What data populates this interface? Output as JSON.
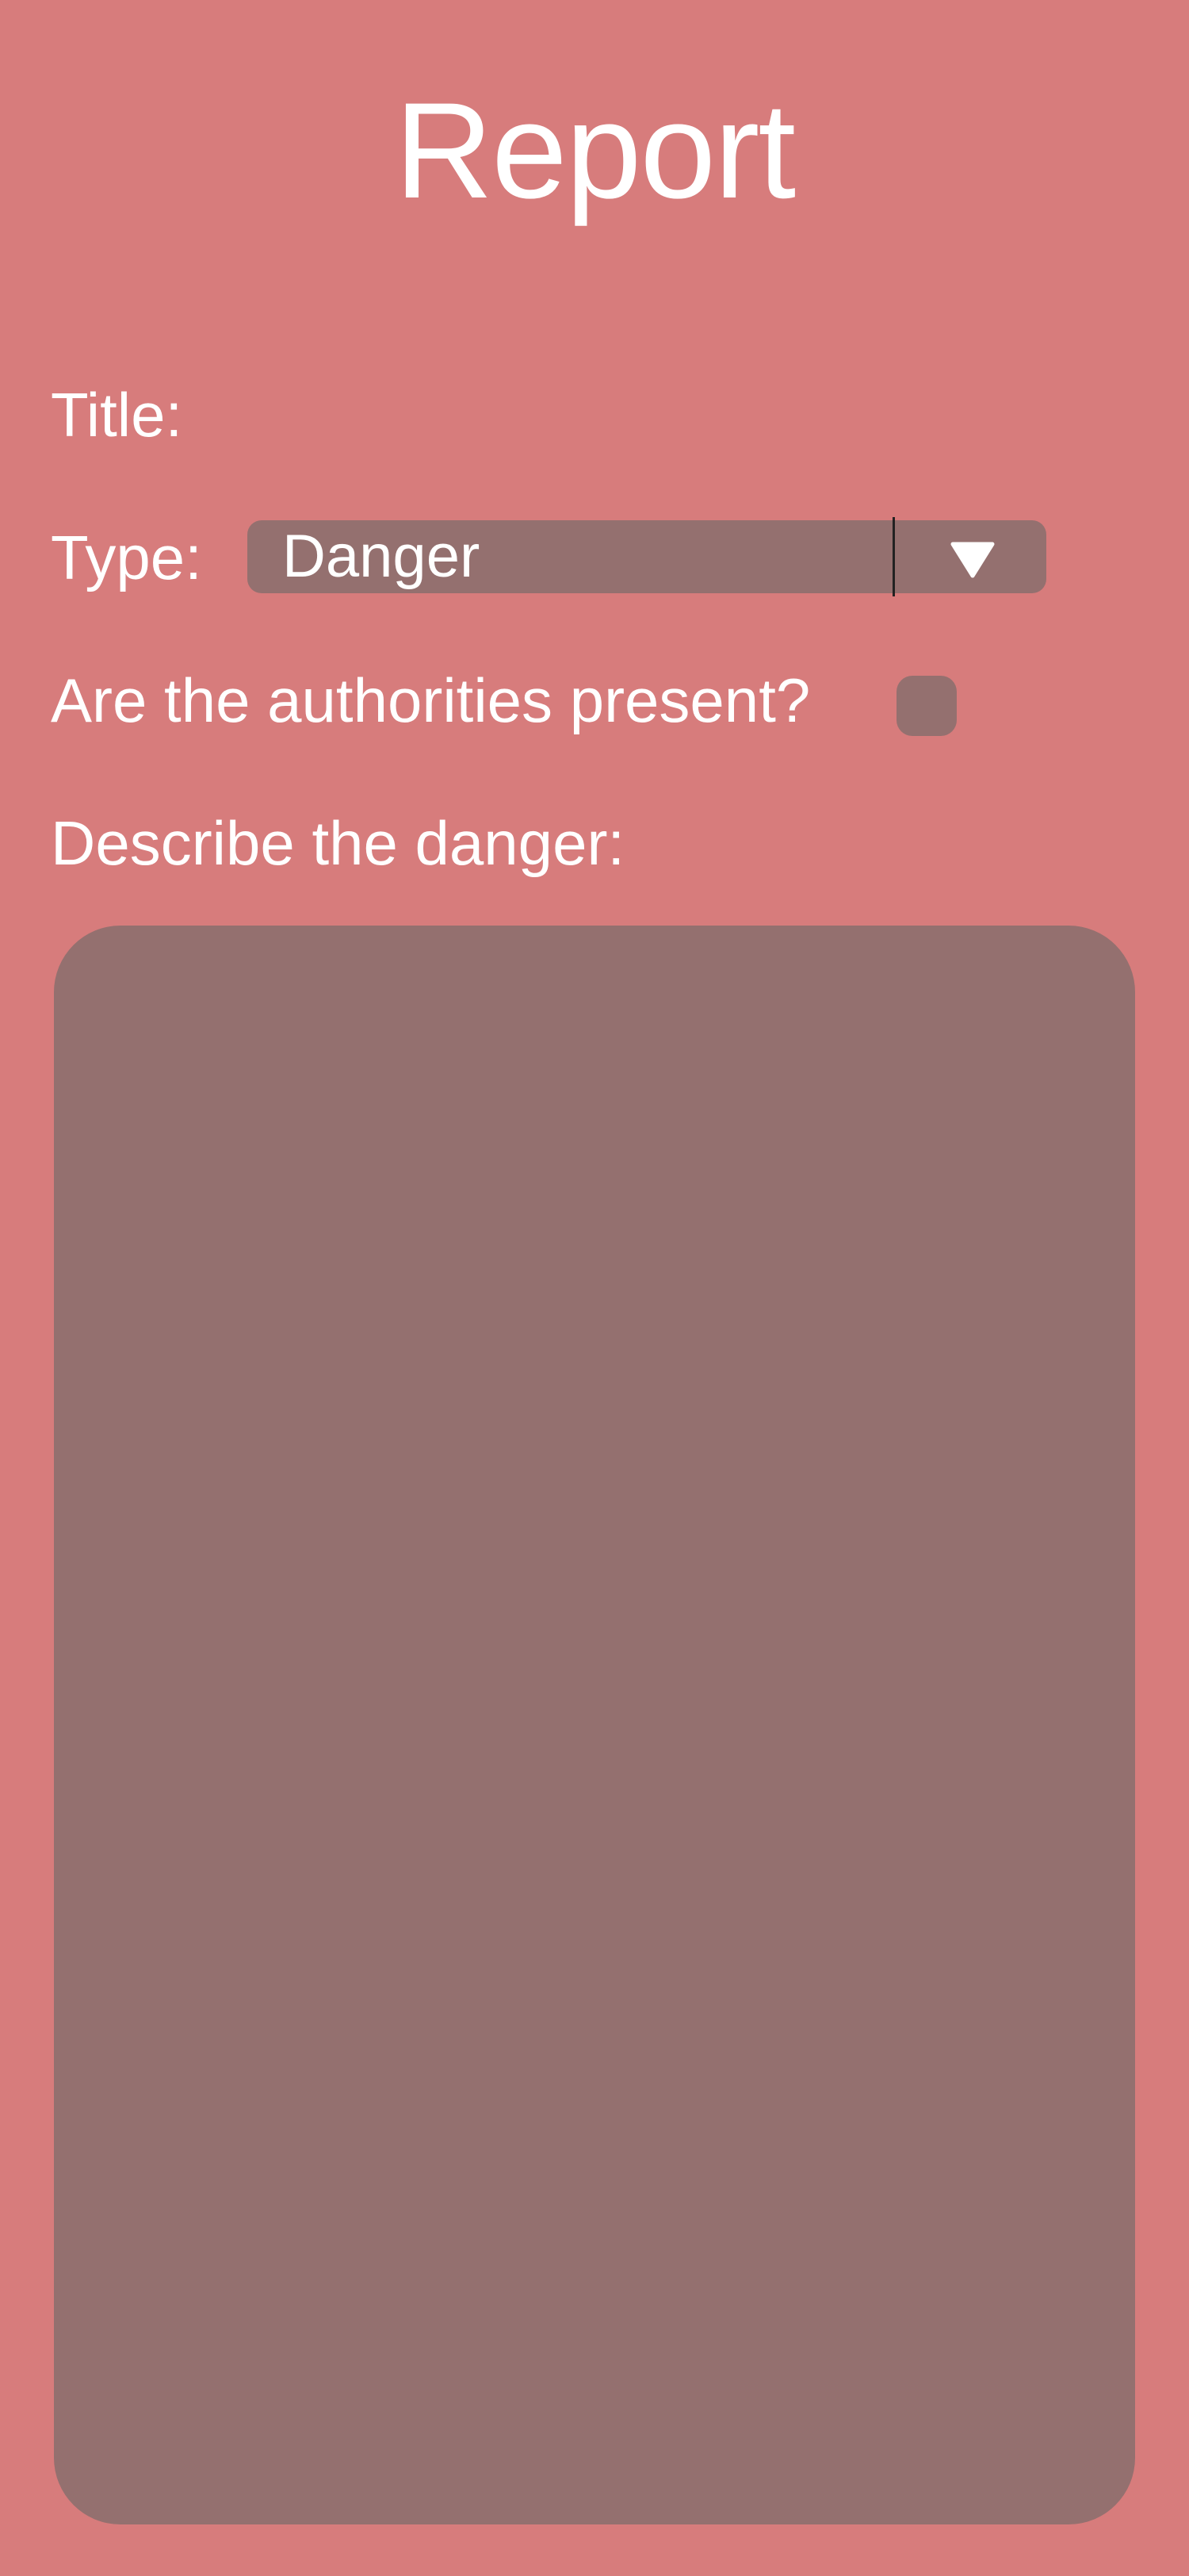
{
  "header": {
    "title": "Report"
  },
  "form": {
    "title_label": "Title:",
    "type_label": "Type:",
    "type_value": "Danger",
    "authorities_label": "Are the authorities present?",
    "authorities_checked": false,
    "describe_label": "Describe the danger:",
    "description_value": ""
  },
  "icons": {
    "dropdown": "chevron-down-icon"
  },
  "colors": {
    "background": "#d77c7c",
    "control_fill": "#94706f",
    "text": "#ffffff"
  }
}
